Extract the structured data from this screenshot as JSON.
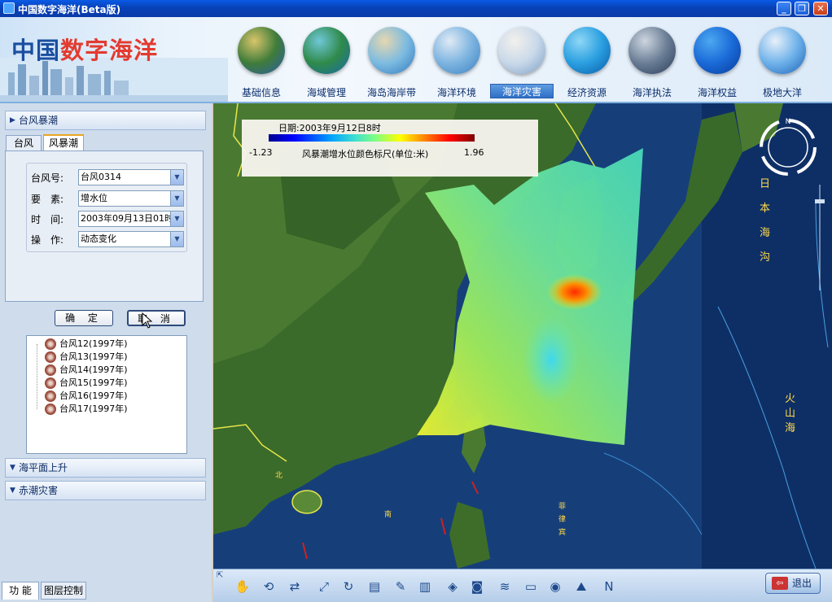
{
  "window": {
    "title": "中国数字海洋(Beta版)",
    "buttons": [
      "_",
      "❐",
      "✕"
    ]
  },
  "header": {
    "logo_part1": "中国",
    "logo_part2": "数字海洋",
    "nav": [
      {
        "label": "基础信息",
        "colors": [
          "#d9c56a",
          "#3f7c3a",
          "#2a5da8"
        ]
      },
      {
        "label": "海域管理",
        "colors": [
          "#6fc7d8",
          "#2f8a4a",
          "#1a6aa8"
        ]
      },
      {
        "label": "海岛海岸带",
        "colors": [
          "#e6d7b0",
          "#7dbbe0",
          "#2f79c0"
        ]
      },
      {
        "label": "海洋环境",
        "colors": [
          "#dfeaf5",
          "#7db4e0",
          "#3a7fc0"
        ]
      },
      {
        "label": "海洋灾害",
        "colors": [
          "#f3f0ec",
          "#c9d9ea",
          "#7a9ec4"
        ]
      },
      {
        "label": "经济资源",
        "colors": [
          "#8fd7f5",
          "#2a9fe0",
          "#0a5aa8"
        ]
      },
      {
        "label": "海洋执法",
        "colors": [
          "#cdd6e0",
          "#6a7d95",
          "#2a3d5a"
        ]
      },
      {
        "label": "海洋权益",
        "colors": [
          "#4da8f0",
          "#1a6ad8",
          "#083a98"
        ]
      },
      {
        "label": "极地大洋",
        "colors": [
          "#e7f0fa",
          "#6fb2ea",
          "#1a62b8"
        ]
      }
    ],
    "active_nav": "海洋灾害"
  },
  "sidebar": {
    "section_typhoon_surge": "台风暴潮",
    "tabs": [
      "台风",
      "风暴潮"
    ],
    "active_tab": "风暴潮",
    "fields": [
      {
        "label": "台风号:",
        "value": "台风0314"
      },
      {
        "label": "要　素:",
        "value": "增水位"
      },
      {
        "label": "时　间:",
        "value": "2003年09月13日01时"
      },
      {
        "label": "操　作:",
        "value": "动态变化"
      }
    ],
    "confirm_label": "确 定",
    "cancel_label": "取 消",
    "typhoon_list": [
      "台风12(1997年)",
      "台风13(1997年)",
      "台风14(1997年)",
      "台风15(1997年)",
      "台风16(1997年)",
      "台风17(1997年)"
    ],
    "section_sea_level": "海平面上升",
    "section_red_tide": "赤潮灾害",
    "bottom_tabs": [
      "功 能",
      "图层控制"
    ]
  },
  "map": {
    "legend_date": "日期:2003年9月12日8时",
    "legend_title": "风暴潮增水位颜色标尺(单位:米)",
    "legend_min": "-1.23",
    "legend_max": "1.96",
    "labels": {
      "sea_of_japan": "日本海沟",
      "volcano": "火山海",
      "north": "北",
      "nan": "南",
      "philippine": "菲律宾"
    },
    "compass_n": "N"
  },
  "toolbar": {
    "icons": [
      "hand-icon",
      "pan-icon",
      "rotate-icon",
      "zoom-icon",
      "refresh-icon",
      "layer-icon",
      "measure-icon",
      "buildings-icon",
      "diamond-icon",
      "camera-icon",
      "terrain-icon",
      "scale-icon",
      "eye-icon",
      "profile-icon",
      "north-icon"
    ],
    "icon_glyphs": [
      "✋",
      "⟲",
      "⇄",
      "⤢",
      "↻",
      "▤",
      "✎",
      "▥",
      "◈",
      "◙",
      "≋",
      "▭",
      "◉",
      "⛰",
      "N"
    ],
    "exit_label": "退出"
  }
}
